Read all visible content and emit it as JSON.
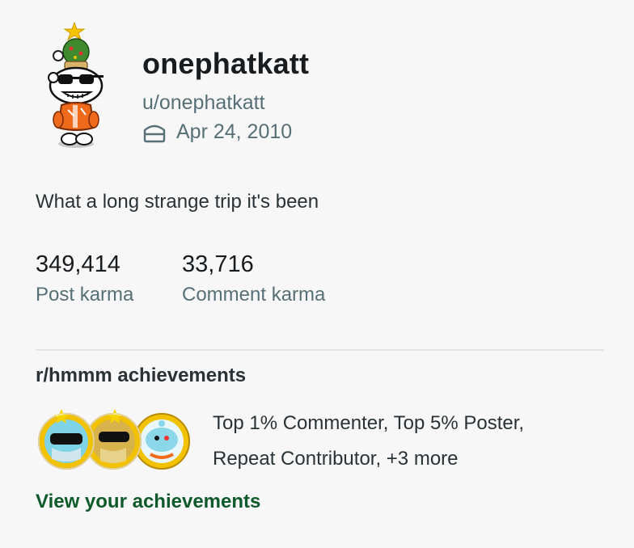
{
  "profile": {
    "display_name": "onephatkatt",
    "handle": "u/onephatkatt",
    "cake_day": "Apr 24, 2010",
    "bio": "What a long strange trip it's been",
    "avatar_icon": "snoo-avatar-christmas-tree-hat"
  },
  "karma": {
    "post_value": "349,414",
    "post_label": "Post karma",
    "comment_value": "33,716",
    "comment_label": "Comment karma"
  },
  "achievements": {
    "title": "r/hmmm achievements",
    "description_line1": "Top 1% Commenter, Top 5% Poster,",
    "description_line2": "Repeat Contributor, +3 more",
    "badges": [
      "top-commenter-badge-icon",
      "top-poster-badge-icon",
      "repeat-contributor-badge-icon"
    ],
    "view_link": "View your achievements"
  },
  "colors": {
    "link_green": "#0e5a2a",
    "muted_text": "#576f76",
    "badge_gold": "#f2c200"
  }
}
